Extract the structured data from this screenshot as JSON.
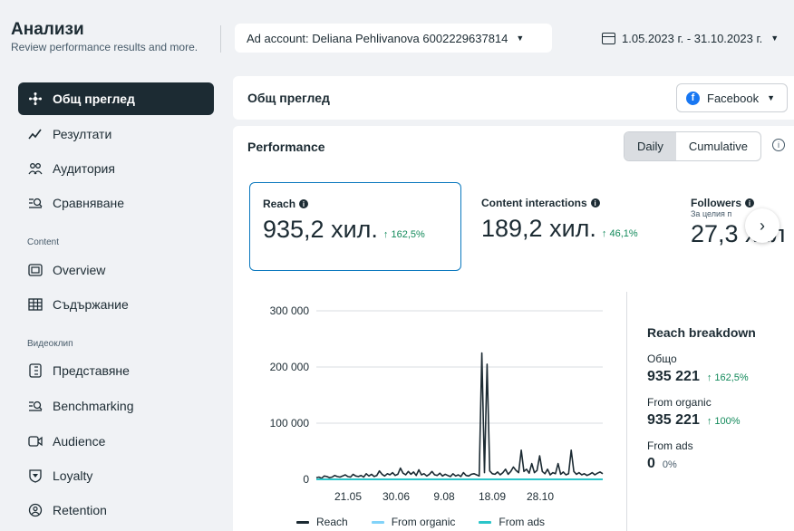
{
  "header": {
    "title": "Анализи",
    "subtitle": "Review performance results and more.",
    "ad_account": "Ad account: Deliana Pehlivanova 6002229637814",
    "date_range": "1.05.2023 г. - 31.10.2023 г."
  },
  "sidebar": {
    "items": [
      {
        "label": "Общ преглед",
        "icon": "overview-icon"
      },
      {
        "label": "Резултати",
        "icon": "results-icon"
      },
      {
        "label": "Аудитория",
        "icon": "audience-icon"
      },
      {
        "label": "Сравняване",
        "icon": "compare-icon"
      }
    ],
    "content_section": "Content",
    "content_items": [
      {
        "label": "Overview",
        "icon": "gallery-icon"
      },
      {
        "label": "Съдържание",
        "icon": "table-icon"
      }
    ],
    "video_section": "Видеоклип",
    "video_items": [
      {
        "label": "Представяне",
        "icon": "document-icon"
      },
      {
        "label": "Benchmarking",
        "icon": "compare-icon"
      },
      {
        "label": "Audience",
        "icon": "video-icon"
      },
      {
        "label": "Loyalty",
        "icon": "shield-icon"
      },
      {
        "label": "Retention",
        "icon": "retention-icon"
      }
    ]
  },
  "overview": {
    "title": "Общ преглед",
    "platform": "Facebook"
  },
  "performance": {
    "title": "Performance",
    "toggle": [
      "Daily",
      "Cumulative"
    ],
    "metrics": [
      {
        "label": "Reach",
        "value": "935,2 хил.",
        "change": "↑ 162,5%"
      },
      {
        "label": "Content interactions",
        "value": "189,2 хил.",
        "change": "↑ 46,1%"
      },
      {
        "label": "Followers",
        "sub": "За целия п",
        "value": "27,3 хил"
      }
    ]
  },
  "breakdown": {
    "title": "Reach breakdown",
    "rows": [
      {
        "label": "Общо",
        "value": "935 221",
        "change": "↑ 162,5%"
      },
      {
        "label": "From organic",
        "value": "935 221",
        "change": "↑ 100%"
      },
      {
        "label": "From ads",
        "value": "0",
        "change": "0%"
      }
    ]
  },
  "chart_data": {
    "type": "line",
    "title": "",
    "xlabel": "",
    "ylabel": "",
    "ylim": [
      0,
      300000
    ],
    "yticks": [
      "300 000",
      "200 000",
      "100 000",
      "0"
    ],
    "xticks": [
      "21.05",
      "30.06",
      "9.08",
      "18.09",
      "28.10"
    ],
    "legend_position": "bottom",
    "series": [
      {
        "name": "Reach",
        "color": "#1c2b33",
        "values": [
          3000,
          4000,
          2000,
          6000,
          5000,
          3000,
          4000,
          7000,
          5000,
          4000,
          6000,
          8000,
          5000,
          4000,
          9000,
          6000,
          5000,
          7000,
          4000,
          10000,
          6000,
          9000,
          5000,
          7000,
          15000,
          9000,
          6000,
          10000,
          8000,
          12000,
          7000,
          9000,
          20000,
          11000,
          8000,
          14000,
          9000,
          13000,
          7000,
          17000,
          8000,
          10000,
          6000,
          9000,
          14000,
          8000,
          7000,
          11000,
          6000,
          9000,
          7000,
          5000,
          10000,
          6000,
          8000,
          5000,
          12000,
          7000,
          6000,
          9000,
          10000,
          8000,
          6000,
          225000,
          12000,
          205000,
          15000,
          10000,
          9000,
          13000,
          8000,
          12000,
          18000,
          9000,
          14000,
          22000,
          16000,
          12000,
          52000,
          14000,
          18000,
          11000,
          28000,
          12000,
          16000,
          42000,
          14000,
          10000,
          18000,
          8000,
          12000,
          10000,
          28000,
          9000,
          13000,
          8000,
          10000,
          52000,
          14000,
          9000,
          12000,
          8000,
          10000,
          7000,
          9000,
          12000,
          8000,
          11000,
          13000,
          10000
        ]
      },
      {
        "name": "From organic",
        "color": "#82d3f9",
        "values": []
      },
      {
        "name": "From ads",
        "color": "#2bc5c9",
        "values": [
          0,
          0
        ]
      }
    ]
  }
}
